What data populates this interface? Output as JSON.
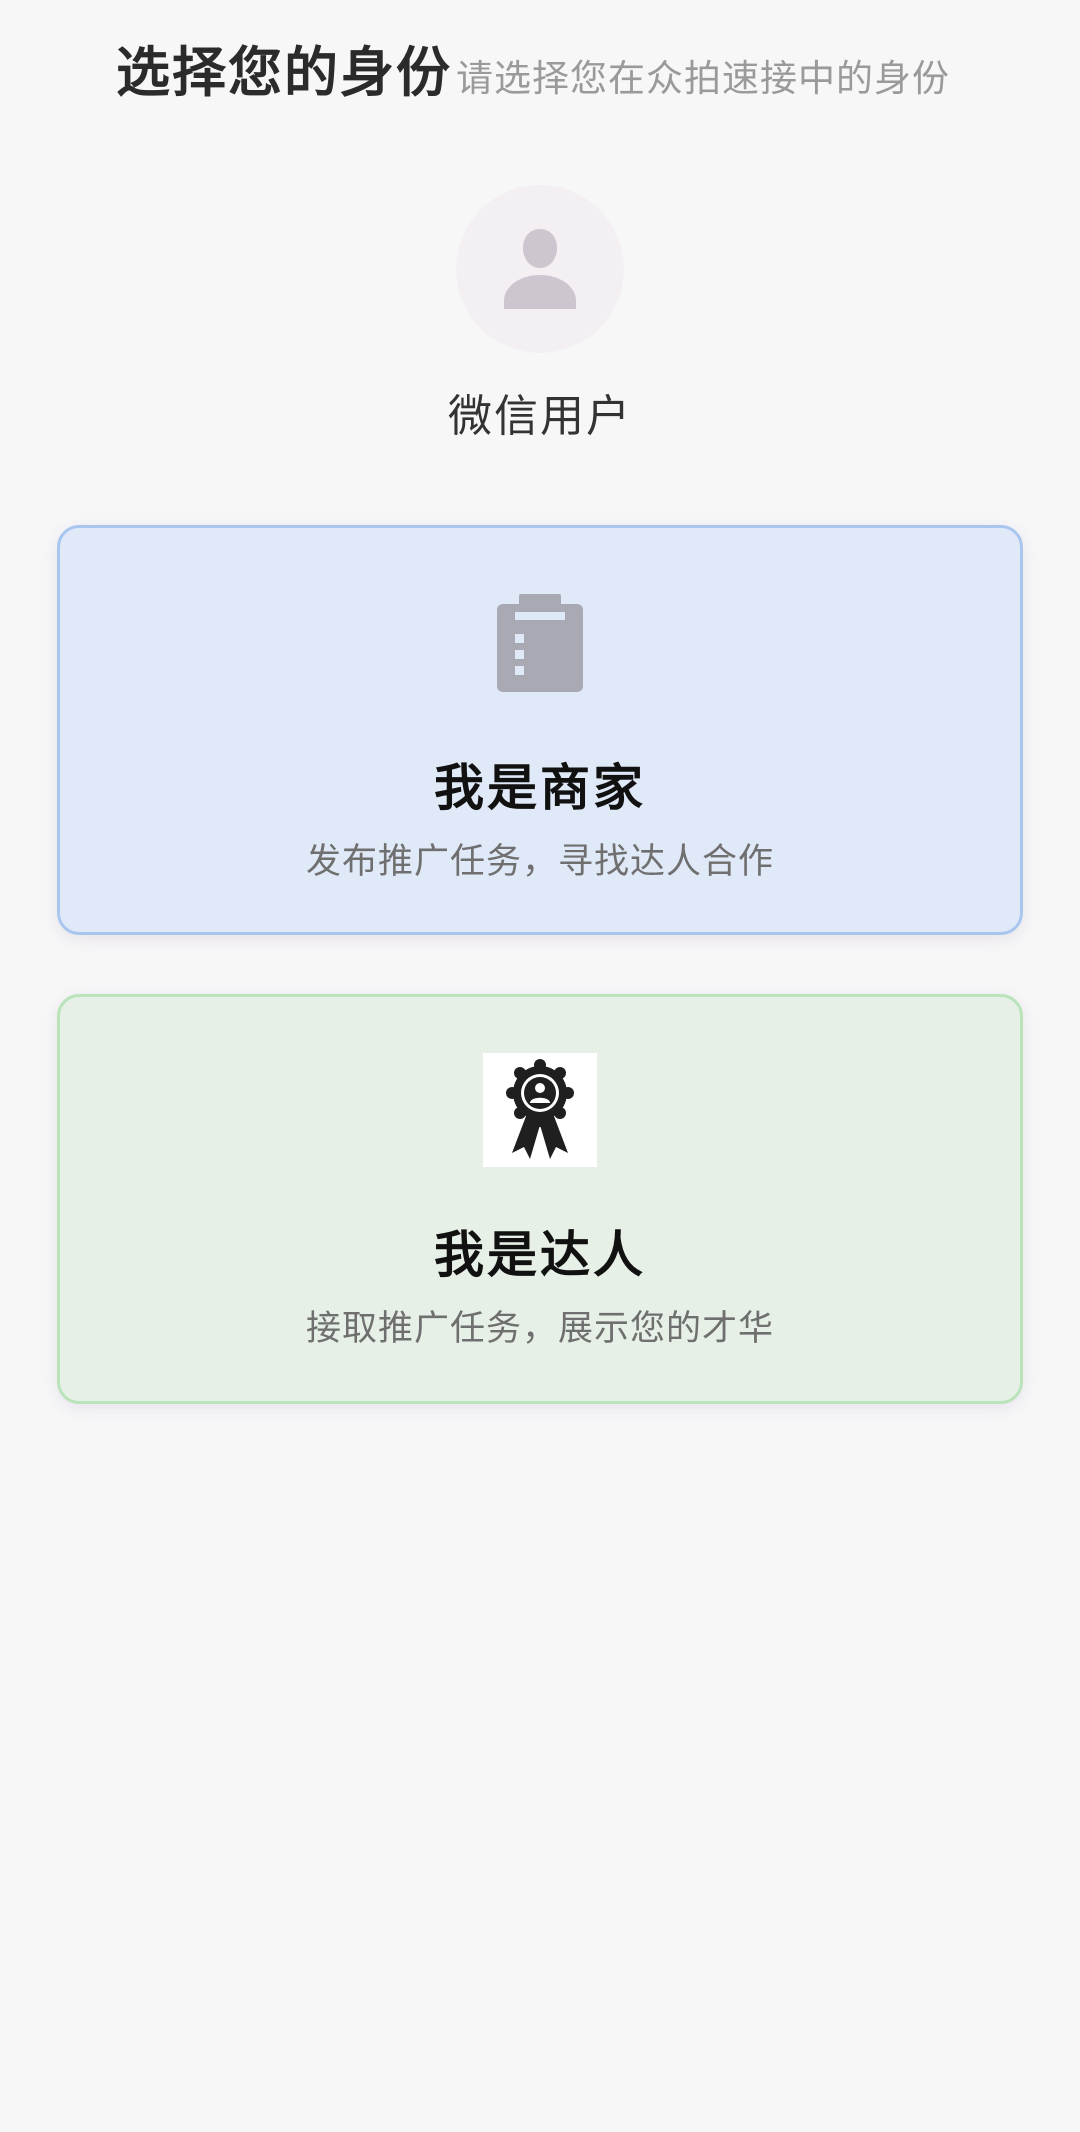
{
  "header": {
    "title": "选择您的身份",
    "subtitle": "请选择您在众拍速接中的身份"
  },
  "profile": {
    "avatar_icon": "person-silhouette-icon",
    "name": "微信用户"
  },
  "roles": [
    {
      "icon": "clipboard-icon",
      "title": "我是商家",
      "description": "发布推广任务，寻找达人合作",
      "accent": "#a9c6ef",
      "background": "#dfe9f7"
    },
    {
      "icon": "award-ribbon-icon",
      "title": "我是达人",
      "description": "接取推广任务，展示您的才华",
      "accent": "#b9e3b9",
      "background": "#e6f0e6"
    }
  ]
}
